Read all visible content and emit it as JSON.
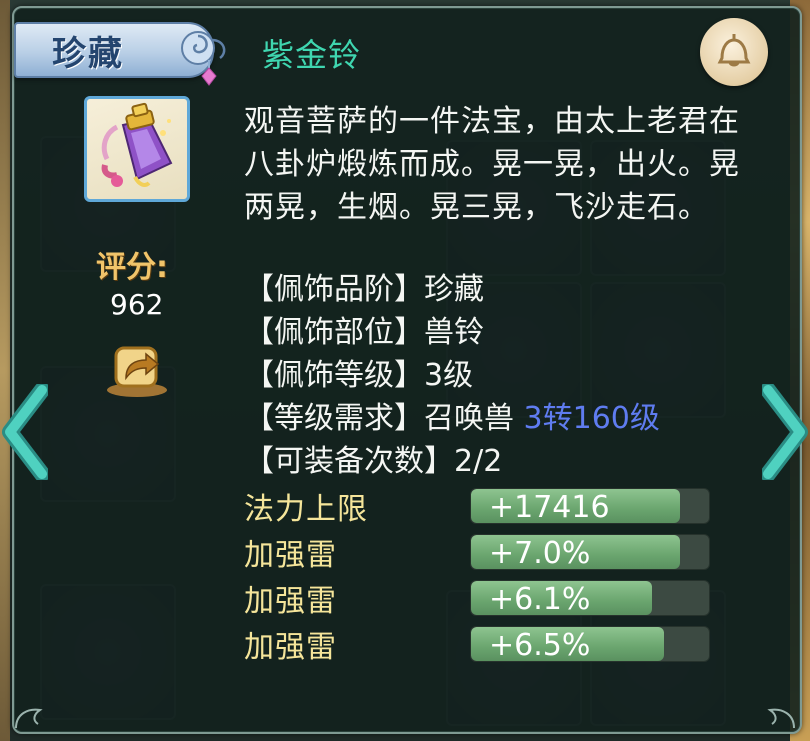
{
  "tooltip": {
    "rarity": "珍藏",
    "item_name": "紫金铃",
    "score_label": "评分:",
    "score_value": "962",
    "description": "观音菩萨的一件法宝，由太上老君在八卦炉煅炼而成。晃一晃，出火。晃两晃，生烟。晃三晃，飞沙走石。",
    "attributes": [
      {
        "text": "【佩饰品阶】珍藏",
        "highlight": ""
      },
      {
        "text": "【佩饰部位】兽铃",
        "highlight": ""
      },
      {
        "text": "【佩饰等级】3级",
        "highlight": ""
      },
      {
        "text": "【等级需求】召唤兽 ",
        "highlight": "3转160级"
      },
      {
        "text": "【可装备次数】2/2",
        "highlight": ""
      }
    ],
    "stats": [
      {
        "name": "法力上限",
        "value": "+17416",
        "fill": 0.88
      },
      {
        "name": "加强雷",
        "value": "+7.0%",
        "fill": 0.88
      },
      {
        "name": "加强雷",
        "value": "+6.1%",
        "fill": 0.76
      },
      {
        "name": "加强雷",
        "value": "+6.5%",
        "fill": 0.81
      }
    ]
  },
  "icons": {
    "item": "purple-bell-icon",
    "share": "share-icon",
    "corner": "bell-icon",
    "prev": "chevron-left-icon",
    "next": "chevron-right-icon"
  },
  "colors": {
    "item_name": "#3fd6b0",
    "stat_name": "#f5e59a",
    "score_label": "#f1c46a",
    "requirement_highlight": "#5f7cf0",
    "bar_fill": "#7ab57d",
    "arrow": "#4fd1c0"
  }
}
